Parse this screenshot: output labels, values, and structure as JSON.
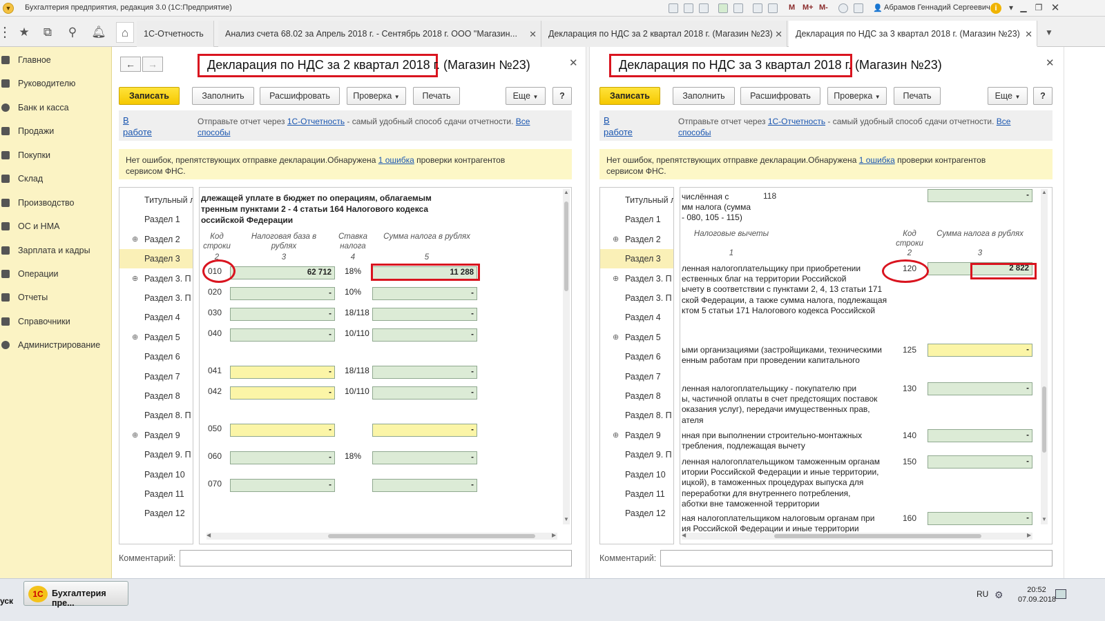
{
  "titlebar": {
    "menu_icon": "chevron-down-icon",
    "title": "Бухгалтерия предприятия, редакция 3.0 (1С:Предприятие)",
    "tools": [
      "M",
      "M+",
      "M-"
    ],
    "user": "Абрамов Геннадий Сергеевич"
  },
  "tabs": [
    {
      "label": "1С-Отчетность",
      "closable": false
    },
    {
      "label": "Анализ счета 68.02 за Апрель 2018 г. - Сентябрь 2018 г. ООО \"Магазин...",
      "closable": true
    },
    {
      "label": "Декларация по НДС за 2 квартал 2018 г. (Магазин №23)",
      "closable": true
    },
    {
      "label": "Декларация по НДС за 3 квартал 2018 г. (Магазин №23)",
      "closable": true
    }
  ],
  "sidebar": {
    "items": [
      {
        "label": "Главное"
      },
      {
        "label": "Руководителю"
      },
      {
        "label": "Банк и касса"
      },
      {
        "label": "Продажи"
      },
      {
        "label": "Покупки"
      },
      {
        "label": "Склад"
      },
      {
        "label": "Производство"
      },
      {
        "label": "ОС и НМА"
      },
      {
        "label": "Зарплата и кадры"
      },
      {
        "label": "Операции"
      },
      {
        "label": "Отчеты"
      },
      {
        "label": "Справочники"
      },
      {
        "label": "Администрирование"
      }
    ]
  },
  "common": {
    "save": "Записать",
    "fill": "Заполнить",
    "decode": "Расшифровать",
    "check": "Проверка",
    "print": "Печать",
    "more": "Еще",
    "help": "?",
    "status_line1": "В",
    "status_line2": "работе",
    "send_pre": "Отправьте отчет через ",
    "send_link": "1С-Отчетность",
    "send_mid": " - самый удобный способ сдачи отчетности. ",
    "send_link2a": "Все",
    "send_link2b": "способы",
    "warn_pre": "Нет ошибок, препятствующих отправке декларации.Обнаружена ",
    "warn_link": "1 ошибка",
    "warn_post": " проверки контрагентов",
    "warn_line2": "сервисом ФНС.",
    "comment_label": "Комментарий:",
    "tree": [
      {
        "label": "Титульный л",
        "plus": false
      },
      {
        "label": "Раздел 1",
        "plus": false
      },
      {
        "label": "Раздел 2",
        "plus": true
      },
      {
        "label": "Раздел 3",
        "plus": false
      },
      {
        "label": "Раздел 3. П",
        "plus": true
      },
      {
        "label": "Раздел 3. П",
        "plus": false
      },
      {
        "label": "Раздел 4",
        "plus": false
      },
      {
        "label": "Раздел 5",
        "plus": true
      },
      {
        "label": "Раздел 6",
        "plus": false
      },
      {
        "label": "Раздел 7",
        "plus": false
      },
      {
        "label": "Раздел 8",
        "plus": false
      },
      {
        "label": "Раздел 8. П",
        "plus": false
      },
      {
        "label": "Раздел 9",
        "plus": true
      },
      {
        "label": "Раздел 9. П",
        "plus": false
      },
      {
        "label": "Раздел 10",
        "plus": false
      },
      {
        "label": "Раздел 11",
        "plus": false
      },
      {
        "label": "Раздел 12",
        "plus": false
      }
    ]
  },
  "left": {
    "title_boxed": "Декларация по НДС за 2 квартал 2018",
    "title_rest": " г. (Магазин №23)",
    "form_heading": [
      "длежащей уплате в бюджет по операциям, облагаемым",
      "тренным пунктами 2 - 4 статьи 164 Налогового кодекса",
      "оссийской Федерации"
    ],
    "col_code": "Код строки",
    "col_code_n": "2",
    "col_base": "Налоговая база в рублях",
    "col_base_n": "3",
    "col_rate": "Ставка налога",
    "col_rate_n": "4",
    "col_sum": "Сумма налога в рублях",
    "col_sum_n": "5",
    "rows": [
      {
        "code": "010",
        "base": "62 712",
        "base_color": "g",
        "rate": "18%",
        "sum": "11 288",
        "sum_color": "g"
      },
      {
        "code": "020",
        "base": "-",
        "base_color": "g",
        "rate": "10%",
        "sum": "-",
        "sum_color": "g"
      },
      {
        "code": "030",
        "base": "-",
        "base_color": "g",
        "rate": "18/118",
        "sum": "-",
        "sum_color": "g"
      },
      {
        "code": "040",
        "base": "-",
        "base_color": "g",
        "rate": "10/110",
        "sum": "-",
        "sum_color": "g"
      },
      {
        "code": "041",
        "base": "-",
        "base_color": "y",
        "rate": "18/118",
        "sum": "-",
        "sum_color": "g"
      },
      {
        "code": "042",
        "base": "-",
        "base_color": "y",
        "rate": "10/110",
        "sum": "-",
        "sum_color": "g"
      },
      {
        "code": "050",
        "base": "-",
        "base_color": "y",
        "rate": "",
        "sum": "-",
        "sum_color": "y"
      },
      {
        "code": "060",
        "base": "-",
        "base_color": "g",
        "rate": "18%",
        "sum": "-",
        "sum_color": "g"
      },
      {
        "code": "070",
        "base": "-",
        "base_color": "g",
        "rate": "",
        "sum": "-",
        "sum_color": "g"
      }
    ]
  },
  "right": {
    "title_boxed": "Декларация по НДС за 3 квартал 2018",
    "title_rest": " г. (Магазин №23)",
    "top_text": [
      "числённая с",
      "мм налога (сумма",
      "- 080, 105 - 115)"
    ],
    "top_code": "118",
    "top_value": "-",
    "section_head": "Налоговые вычеты",
    "section_head_n": "1",
    "col_code": "Код строки",
    "col_code_n": "2",
    "col_sum": "Сумма налога в рублях",
    "col_sum_n": "3",
    "rows": [
      {
        "code": "120",
        "value": "2 822",
        "color": "g",
        "text": [
          "ленная налогоплательщику при приобретении",
          "ественных благ на территории Российской",
          "ычету в соответствии с пунктами 2, 4, 13 статьи 171",
          "ской Федерации, а также сумма налога, подлежащая",
          "ктом 5 статьи 171 Налогового кодекса Российской"
        ]
      },
      {
        "code": "125",
        "value": "-",
        "color": "y",
        "text": [
          "ыми организациями (застройщиками, техническими",
          "енным работам при проведении капитального"
        ]
      },
      {
        "code": "130",
        "value": "-",
        "color": "g",
        "text": [
          "ленная налогоплательщику - покупателю при",
          "ы, частичной оплаты в счет предстоящих поставок",
          "оказания услуг), передачи имущественных прав,",
          "ателя"
        ]
      },
      {
        "code": "140",
        "value": "-",
        "color": "g",
        "text": [
          "нная при выполнении строительно-монтажных",
          "требления, подлежащая вычету"
        ]
      },
      {
        "code": "150",
        "value": "-",
        "color": "g",
        "text": [
          "ленная налогоплательщиком таможенным органам",
          "итории Российской Федерации и иные территории,",
          "ицкой), в таможенных процедурах выпуска для",
          "переработки для внутреннего потребления,",
          "аботки вне таможенной территории"
        ]
      },
      {
        "code": "160",
        "value": "-",
        "color": "g",
        "text": [
          "ная налогоплательщиком налоговым органам при",
          "ия Российской Федерации и иные территории"
        ]
      }
    ]
  },
  "taskbar": {
    "start": "уск",
    "app": "Бухгалтерия пре...",
    "lang": "RU",
    "time": "20:52",
    "date": "07.09.2018"
  },
  "colors": {
    "accent_yellow": "#f5c800",
    "highlight_red": "#d9141f",
    "sidebar_bg": "#fbf3c4",
    "field_green": "#dcebd6",
    "field_yellow": "#fbf5a7"
  }
}
